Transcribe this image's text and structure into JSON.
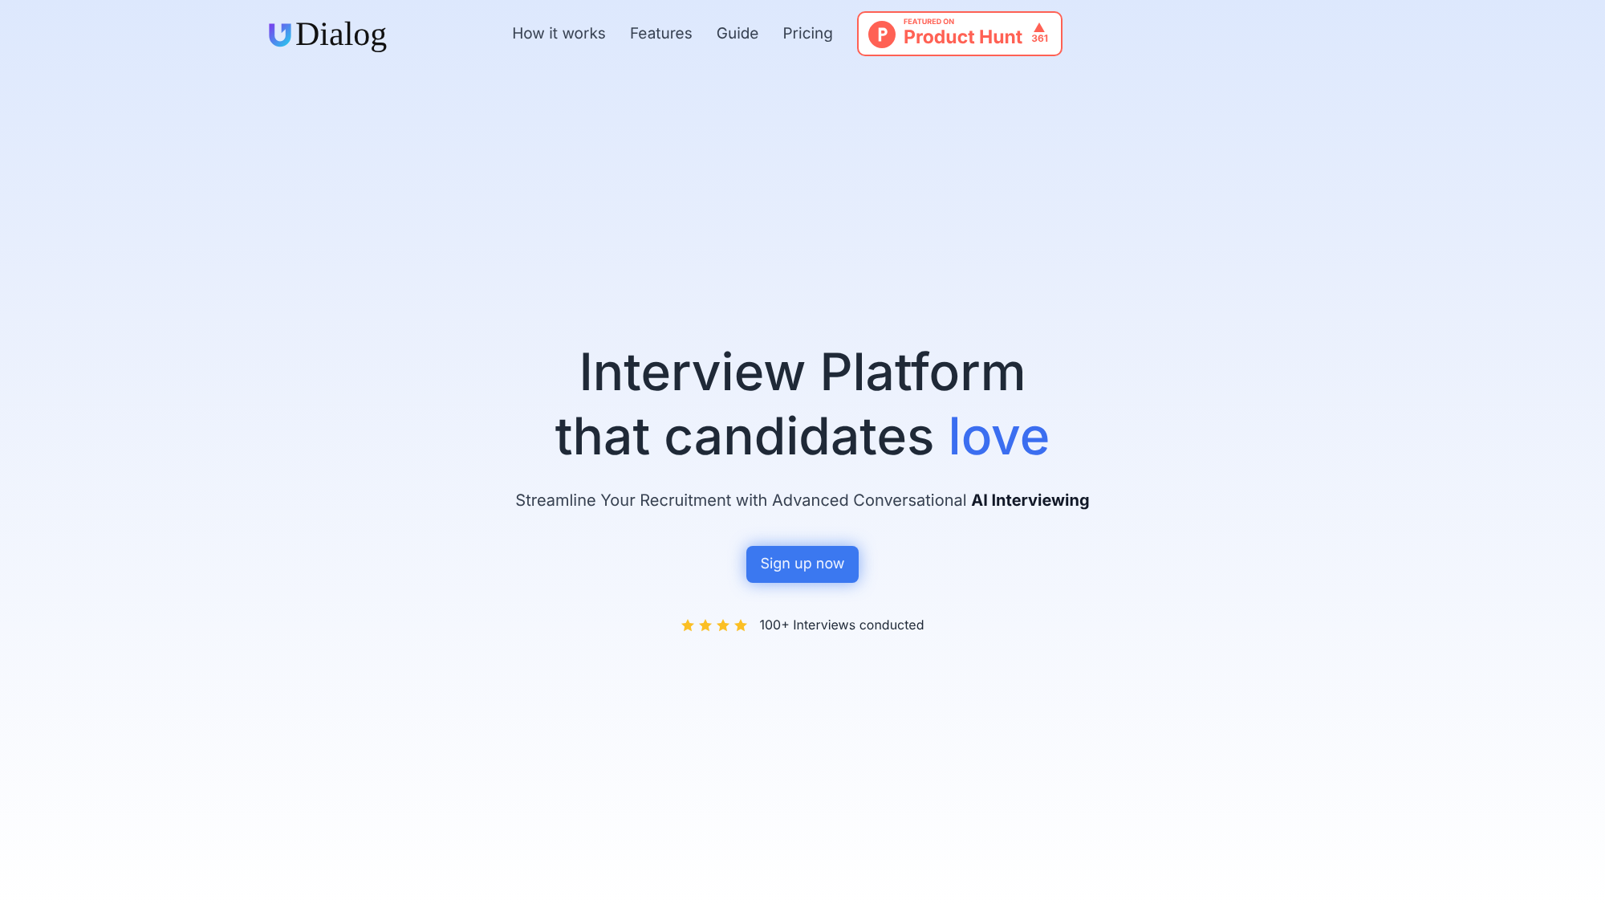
{
  "brand": {
    "name": "Dialog"
  },
  "nav": {
    "links": [
      "How it works",
      "Features",
      "Guide",
      "Pricing"
    ],
    "badge": {
      "caption": "FEATURED ON",
      "name": "Product Hunt",
      "votes": "361"
    }
  },
  "hero": {
    "line_1": "Interview Platform",
    "line_2": "that candidates",
    "accent": "love",
    "subtitle": "Streamline Your Recruitment with Advanced Conversational **AI Interviewing**",
    "cta": "Sign up now",
    "rating": {
      "stars": 4,
      "text": "100+ Interviews conducted"
    }
  }
}
